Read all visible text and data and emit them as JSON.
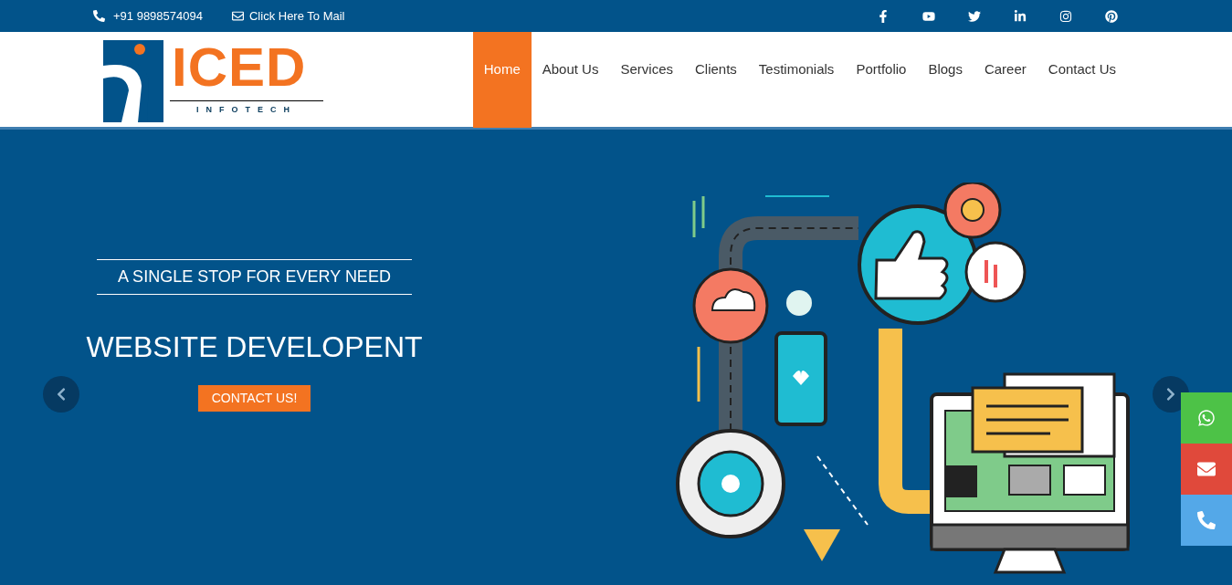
{
  "top_bar": {
    "phone": "+91 9898574094",
    "mail": "Click Here To Mail"
  },
  "logo": {
    "name": "ICED",
    "tagline": "INFOTECH"
  },
  "nav": [
    {
      "label": "Home",
      "selected": true
    },
    {
      "label": "About Us",
      "selected": false
    },
    {
      "label": "Services",
      "selected": false
    },
    {
      "label": "Clients",
      "selected": false
    },
    {
      "label": "Testimonials",
      "selected": false
    },
    {
      "label": "Portfolio",
      "selected": false
    },
    {
      "label": "Blogs",
      "selected": false
    },
    {
      "label": "Career",
      "selected": false
    },
    {
      "label": "Contact Us",
      "selected": false
    }
  ],
  "hero": {
    "tagline": "A SINGLE STOP FOR EVERY NEED",
    "title": "WEBSITE DEVELOPENT",
    "button": "CONTACT US!"
  }
}
